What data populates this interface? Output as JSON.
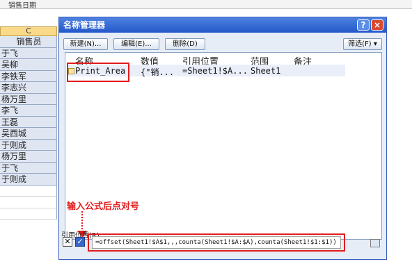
{
  "sheet": {
    "top_label": "销售日期",
    "col_header": "C",
    "header_cell": "销售员",
    "names": [
      "于飞",
      "吴柳",
      "李铁军",
      "李志兴",
      "杨万里",
      "李飞",
      "王磊",
      "吴西城",
      "于则成",
      "杨万里",
      "于飞",
      "于则成"
    ]
  },
  "dialog": {
    "title": "名称管理器",
    "help_label": "?",
    "close_label": "×",
    "toolbar": {
      "new_label": "新建(N)...",
      "edit_label": "编辑(E)...",
      "delete_label": "删除(D)",
      "filter_label": "筛选(F) ▾"
    },
    "columns": {
      "name": "名称",
      "value": "数值",
      "refers": "引用位置",
      "scope": "范围",
      "comment": "备注"
    },
    "rows": [
      {
        "name": "Print_Area",
        "value": "{\"销...",
        "refers": "=Sheet1!$A...",
        "scope": "Sheet1",
        "comment": ""
      }
    ],
    "annotation": "输入公式后点对号",
    "refers_to_label": "引用位置(R):",
    "cancel_glyph": "✕",
    "confirm_glyph": "✓",
    "formula": "=offset(Sheet1!$A$1,,,counta(Sheet1!$A:$A),counta(Sheet1!$1:$1))"
  }
}
